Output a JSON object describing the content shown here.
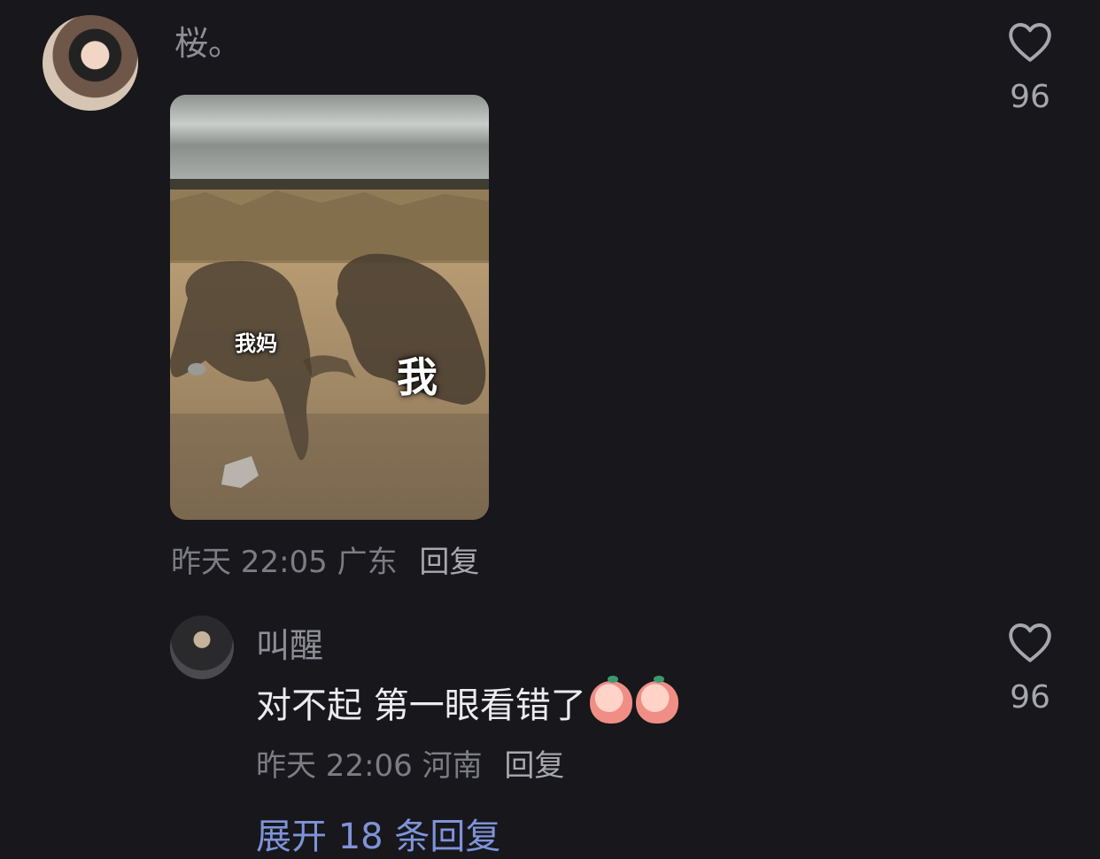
{
  "comment1": {
    "username": "桜。",
    "image_labels": {
      "mom": "我妈",
      "me": "我"
    },
    "time": "昨天 22:05",
    "location": "广东",
    "reply_label": "回复",
    "likes": "96"
  },
  "comment2": {
    "username": "叫醒",
    "text": "对不起 第一眼看错了",
    "time": "昨天 22:06",
    "location": "河南",
    "reply_label": "回复",
    "likes": "96"
  },
  "expand_replies": "展开 18 条回复",
  "colors": {
    "background": "#17171c",
    "link": "#7f93d8",
    "meta": "#7c7c84"
  }
}
